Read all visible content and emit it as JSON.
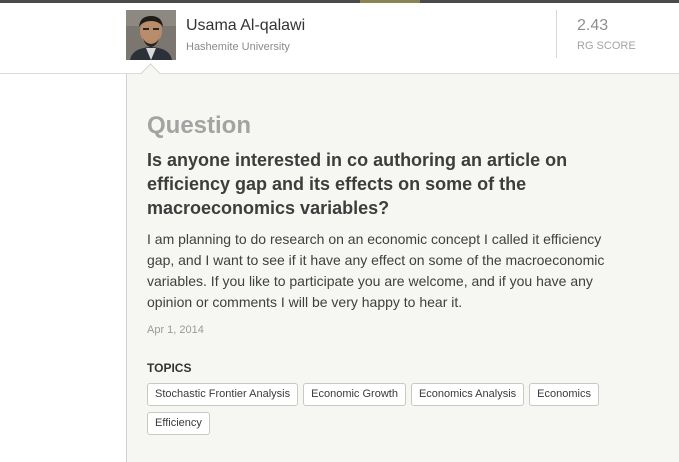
{
  "author": {
    "name": "Usama Al-qalawi",
    "institution": "Hashemite University",
    "rg_score": "2.43",
    "rg_score_label": "RG SCORE"
  },
  "question": {
    "section_label": "Question",
    "title": "Is anyone interested in co authoring an article on efficiency gap and its effects on some of the macroeconomics variables?",
    "body": "I am planning to do research on an economic concept I called it efficiency gap, and I want to see if it have any effect on some of the macroeconomic variables. If you like to participate you are welcome, and if you have any opinion or comments I will be very happy to hear it.",
    "date": "Apr 1, 2014"
  },
  "topics": {
    "heading": "TOPICS",
    "items": [
      "Stochastic Frontier Analysis",
      "Economic Growth",
      "Economics Analysis",
      "Economics",
      "Efficiency"
    ]
  },
  "colors": {
    "panel_background": "#f6f6f2",
    "title_gray": "#a3a3a3",
    "text_dark": "#3d3d3d"
  }
}
